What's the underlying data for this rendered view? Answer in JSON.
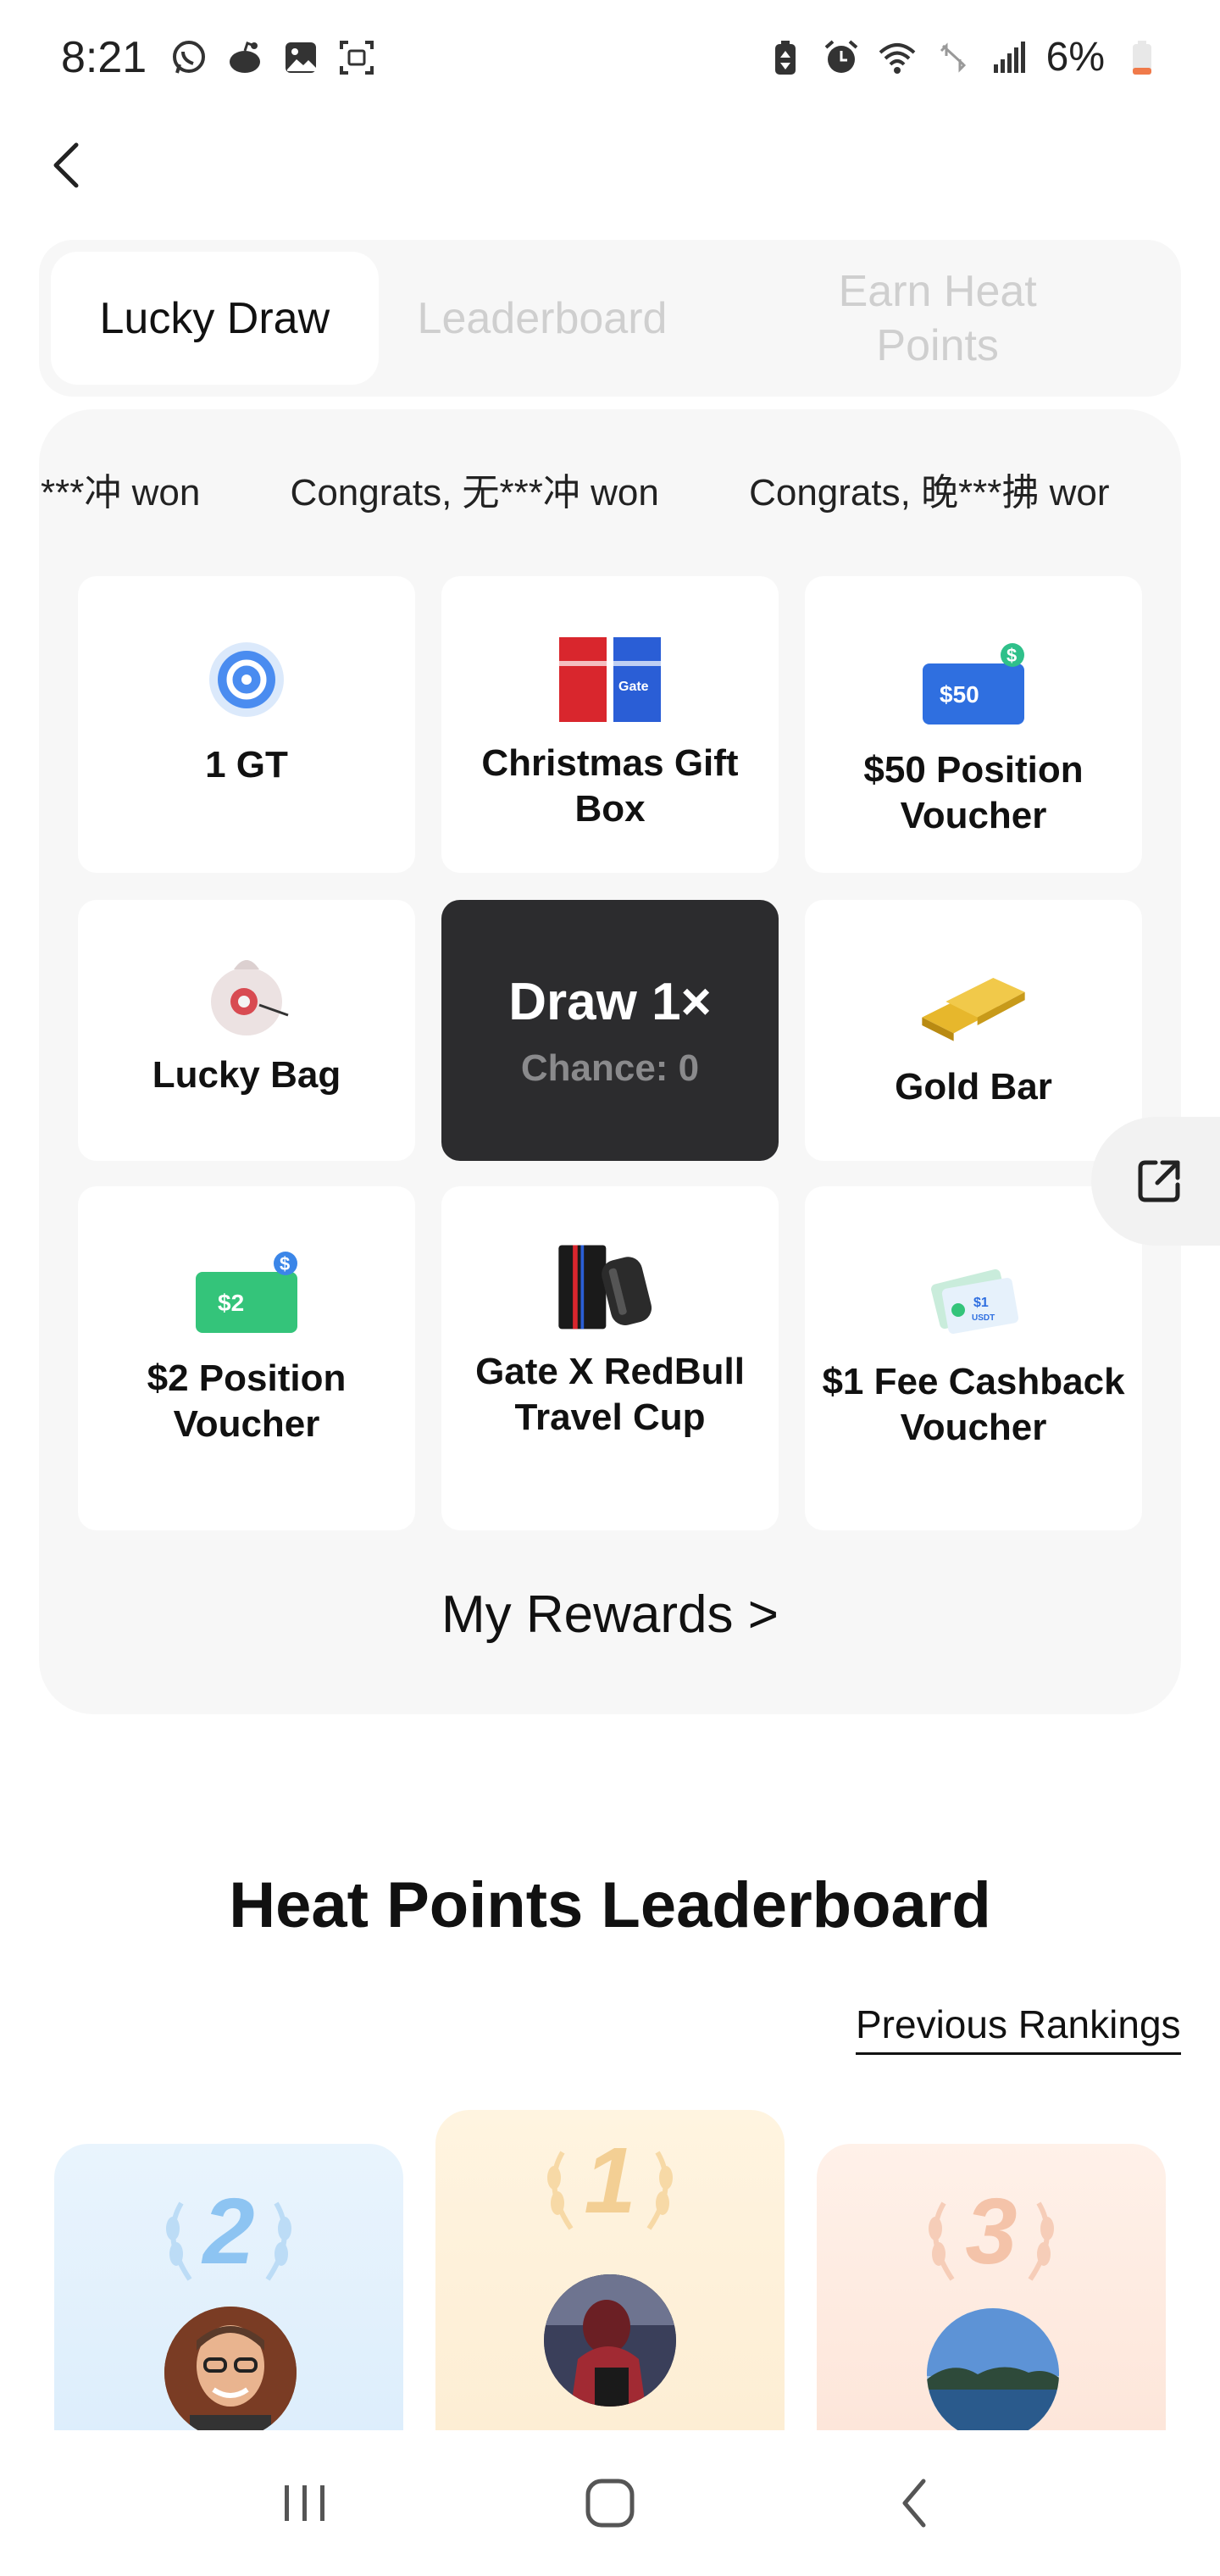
{
  "status_bar": {
    "time": "8:21",
    "battery": "6%",
    "left_icons": [
      "whatsapp-icon",
      "reddit-icon",
      "gallery-icon",
      "screen-record-icon"
    ],
    "right_icons": [
      "battery-saver-icon",
      "alarm-icon",
      "wifi-icon",
      "no-data-icon",
      "signal-icon",
      "battery-icon"
    ]
  },
  "tabs": [
    {
      "label": "Lucky Draw",
      "active": true
    },
    {
      "label": "Leaderboard",
      "active": false
    },
    {
      "label": "Earn Heat Points",
      "active": false
    }
  ],
  "ticker": [
    "***冲 won",
    "Congrats, 无***冲 won",
    "Congrats, 晚***拂 wor"
  ],
  "prizes": [
    {
      "label": "1 GT",
      "icon": "gt-coin-icon"
    },
    {
      "label": "Christmas Gift Box",
      "icon": "gift-box-icon"
    },
    {
      "label": "$50 Position Voucher",
      "icon": "voucher-50-icon"
    },
    {
      "label": "Lucky Bag",
      "icon": "lucky-bag-icon"
    },
    {
      "label": "Gold Bar",
      "icon": "gold-bar-icon"
    },
    {
      "label": "$2 Position Voucher",
      "icon": "voucher-2-icon"
    },
    {
      "label": "Gate X RedBull Travel Cup",
      "icon": "travel-cup-icon"
    },
    {
      "label": "$1 Fee Cashback Voucher",
      "icon": "cashback-voucher-icon"
    }
  ],
  "voucher_text": {
    "v50": "$50",
    "v2": "$2",
    "v1": "$1",
    "usdt": "USDT",
    "gate": "Gate"
  },
  "draw": {
    "label": "Draw 1×",
    "chance": "Chance: 0"
  },
  "my_rewards": "My Rewards >",
  "leaderboard": {
    "title": "Heat Points Leaderboard",
    "previous_rankings": "Previous Rankings",
    "podium": [
      {
        "rank": "2",
        "color": "#bcdcf6"
      },
      {
        "rank": "1",
        "color": "#f7d9a6"
      },
      {
        "rank": "3",
        "color": "#f6cdb8"
      }
    ]
  },
  "colors": {
    "dark": "#2c2c2e",
    "panel": "#f7f7f7",
    "voucher_blue": "#2f6fe0",
    "voucher_green": "#34c47a",
    "gold": "#e0b32a"
  }
}
